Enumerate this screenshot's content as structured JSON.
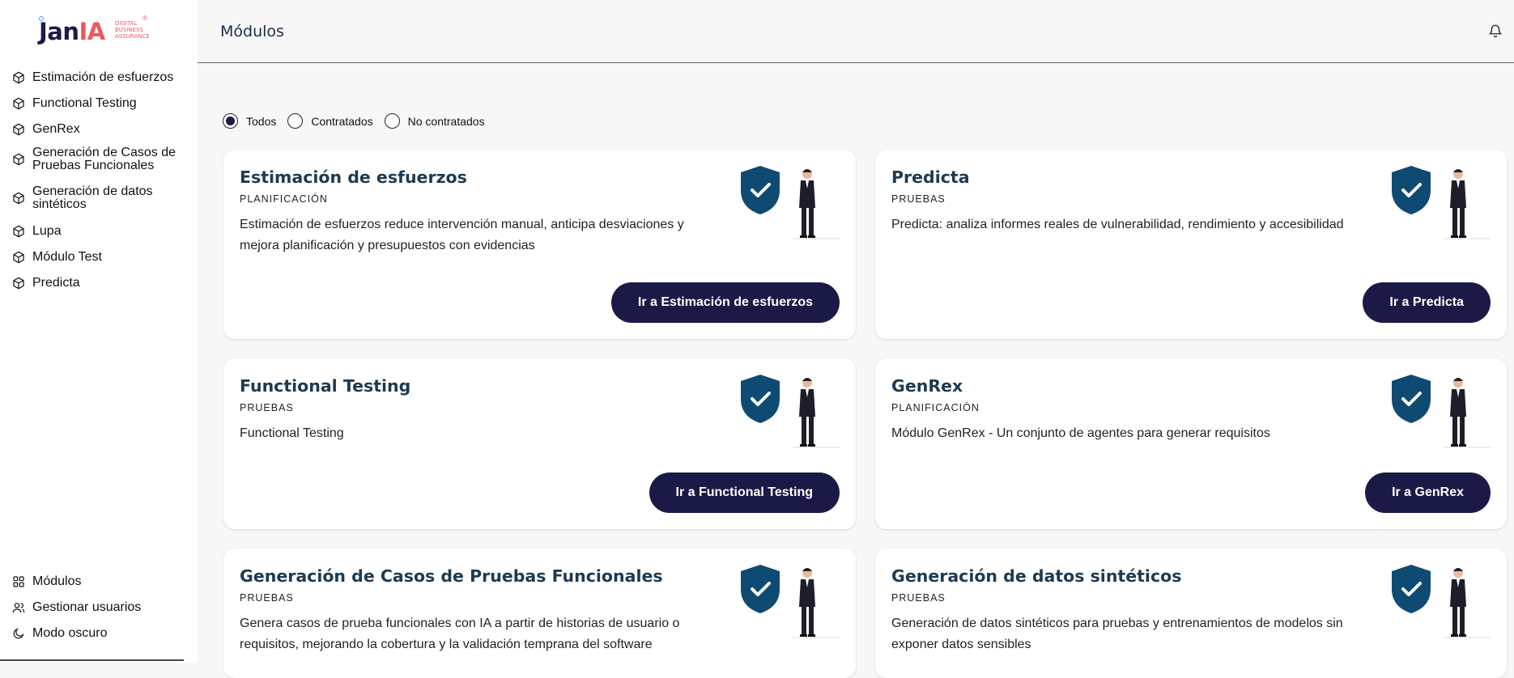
{
  "logo": {
    "brand_a": "Jan",
    "brand_b": "IA",
    "tagline": [
      "DIGITAL",
      "BUSINESS",
      "ASSURANCE"
    ],
    "reg": "®"
  },
  "sidebar": {
    "items": [
      {
        "label": "Estimación de esfuerzos",
        "icon": "cube-icon"
      },
      {
        "label": "Functional Testing",
        "icon": "cube-icon"
      },
      {
        "label": "GenRex",
        "icon": "cube-icon"
      },
      {
        "label": "Generación de Casos de Pruebas Funcionales",
        "icon": "cube-icon"
      },
      {
        "label": "Generación de datos sintéticos",
        "icon": "cube-icon"
      },
      {
        "label": "Lupa",
        "icon": "cube-icon"
      },
      {
        "label": "Módulo Test",
        "icon": "cube-icon"
      },
      {
        "label": "Predicta",
        "icon": "cube-icon"
      }
    ],
    "bottom": [
      {
        "label": "Módulos",
        "icon": "grid-icon"
      },
      {
        "label": "Gestionar usuarios",
        "icon": "users-icon"
      },
      {
        "label": "Modo oscuro",
        "icon": "moon-icon"
      }
    ]
  },
  "header": {
    "title": "Módulos",
    "bell_icon": "bell-icon"
  },
  "filters": {
    "options": [
      "Todos",
      "Contratados",
      "No contratados"
    ],
    "selected": "Todos"
  },
  "cards": [
    {
      "title": "Estimación de esfuerzos",
      "category": "PLANIFICACIÓN",
      "description": "Estimación de esfuerzos reduce intervención manual, anticipa desviaciones y mejora planificación y presupuestos con evidencias",
      "button": "Ir a Estimación de esfuerzos"
    },
    {
      "title": "Predicta",
      "category": "PRUEBAS",
      "description": "Predicta: analiza informes reales de vulnerabilidad, rendimiento y accesibilidad",
      "button": "Ir a Predicta"
    },
    {
      "title": "Functional Testing",
      "category": "PRUEBAS",
      "description": "Functional Testing",
      "button": "Ir a Functional Testing"
    },
    {
      "title": "GenRex",
      "category": "PLANIFICACIÓN",
      "description": "Módulo GenRex - Un conjunto de agentes para generar requisitos",
      "button": "Ir a GenRex"
    },
    {
      "title": "Generación de Casos de Pruebas Funcionales",
      "category": "PRUEBAS",
      "description": "Genera casos de prueba funcionales con IA a partir de historias de usuario o requisitos, mejorando la cobertura y la validación temprana del software",
      "button": ""
    },
    {
      "title": "Generación de datos sintéticos",
      "category": "PRUEBAS",
      "description": "Generación de datos sintéticos para pruebas y entrenamientos de modelos sin exponer datos sensibles",
      "button": ""
    }
  ],
  "colors": {
    "primary": "#1b1a47",
    "title": "#1d3a52",
    "shield": "#0f4a72",
    "accent": "#f0575a"
  }
}
